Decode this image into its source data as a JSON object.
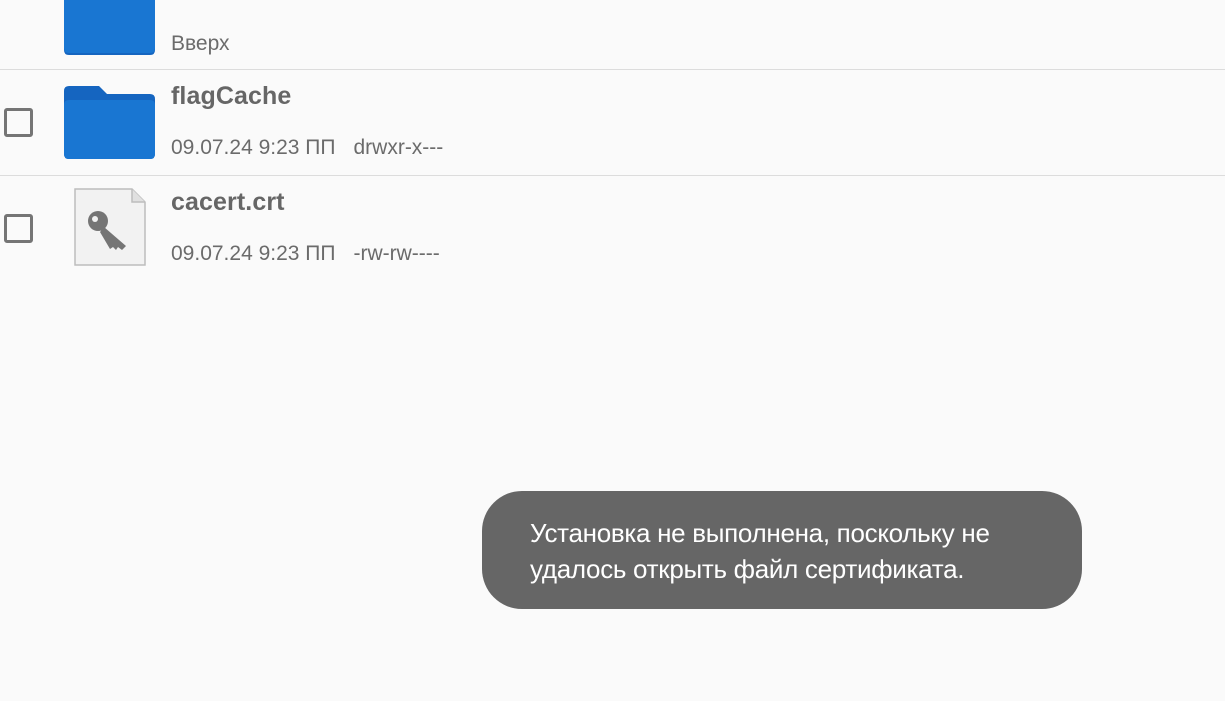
{
  "list": {
    "up_item": {
      "name": "..",
      "subtitle": "Вверх",
      "icon": "folder-icon"
    },
    "items": [
      {
        "name": "flagCache",
        "date": "09.07.24 9:23 ПП",
        "permissions": "drwxr-x---",
        "icon": "folder-icon",
        "checked": false
      },
      {
        "name": "cacert.crt",
        "date": "09.07.24 9:23 ПП",
        "permissions": "-rw-rw----",
        "icon": "key-file-icon",
        "checked": false
      }
    ]
  },
  "toast": {
    "message": "Установка не выполнена, поскольку не удалось открыть файл сертификата."
  },
  "colors": {
    "folder_blue": "#1976d2",
    "folder_blue_dark": "#1565c0",
    "toast_bg": "#666666",
    "background": "#fafafa",
    "divider": "#dcdcdc"
  }
}
